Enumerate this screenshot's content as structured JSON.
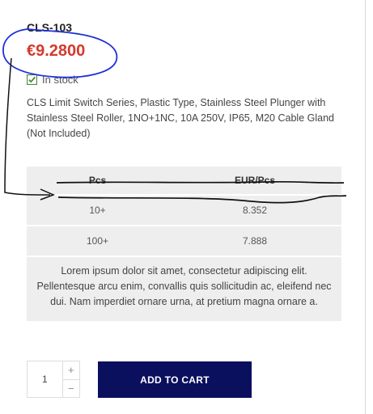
{
  "product": {
    "sku": "CLS-103",
    "price": "€9.2800",
    "stock_label": "In stock",
    "description": "CLS Limit Switch Series, Plastic Type, Stainless Steel Plunger with Stainless Steel Roller, 1NO+1NC, 10A 250V, IP65, M20 Cable Gland (Not Included)"
  },
  "tier_table": {
    "headers": [
      "Pcs",
      "EUR/Pcs"
    ],
    "rows": [
      {
        "qty": "10+",
        "price": "8.352"
      },
      {
        "qty": "100+",
        "price": "7.888"
      }
    ],
    "note": "Lorem ipsum dolor sit amet, consectetur adipiscing elit. Pellentesque arcu enim, convallis quis sollicitudin ac, eleifend nec dui. Nam imperdiet ornare urna, at pretium magna ornare a."
  },
  "cart": {
    "quantity": "1",
    "plus_label": "+",
    "minus_label": "−",
    "add_label": "ADD TO CART"
  },
  "colors": {
    "price": "#d33a2c",
    "stock_check": "#4b8a3a",
    "button_bg": "#0a0f5e",
    "annotation_ink_blue": "#1d2fd8",
    "annotation_ink_black": "#111111"
  },
  "icons": {
    "stock": "checkbox-check-icon"
  }
}
